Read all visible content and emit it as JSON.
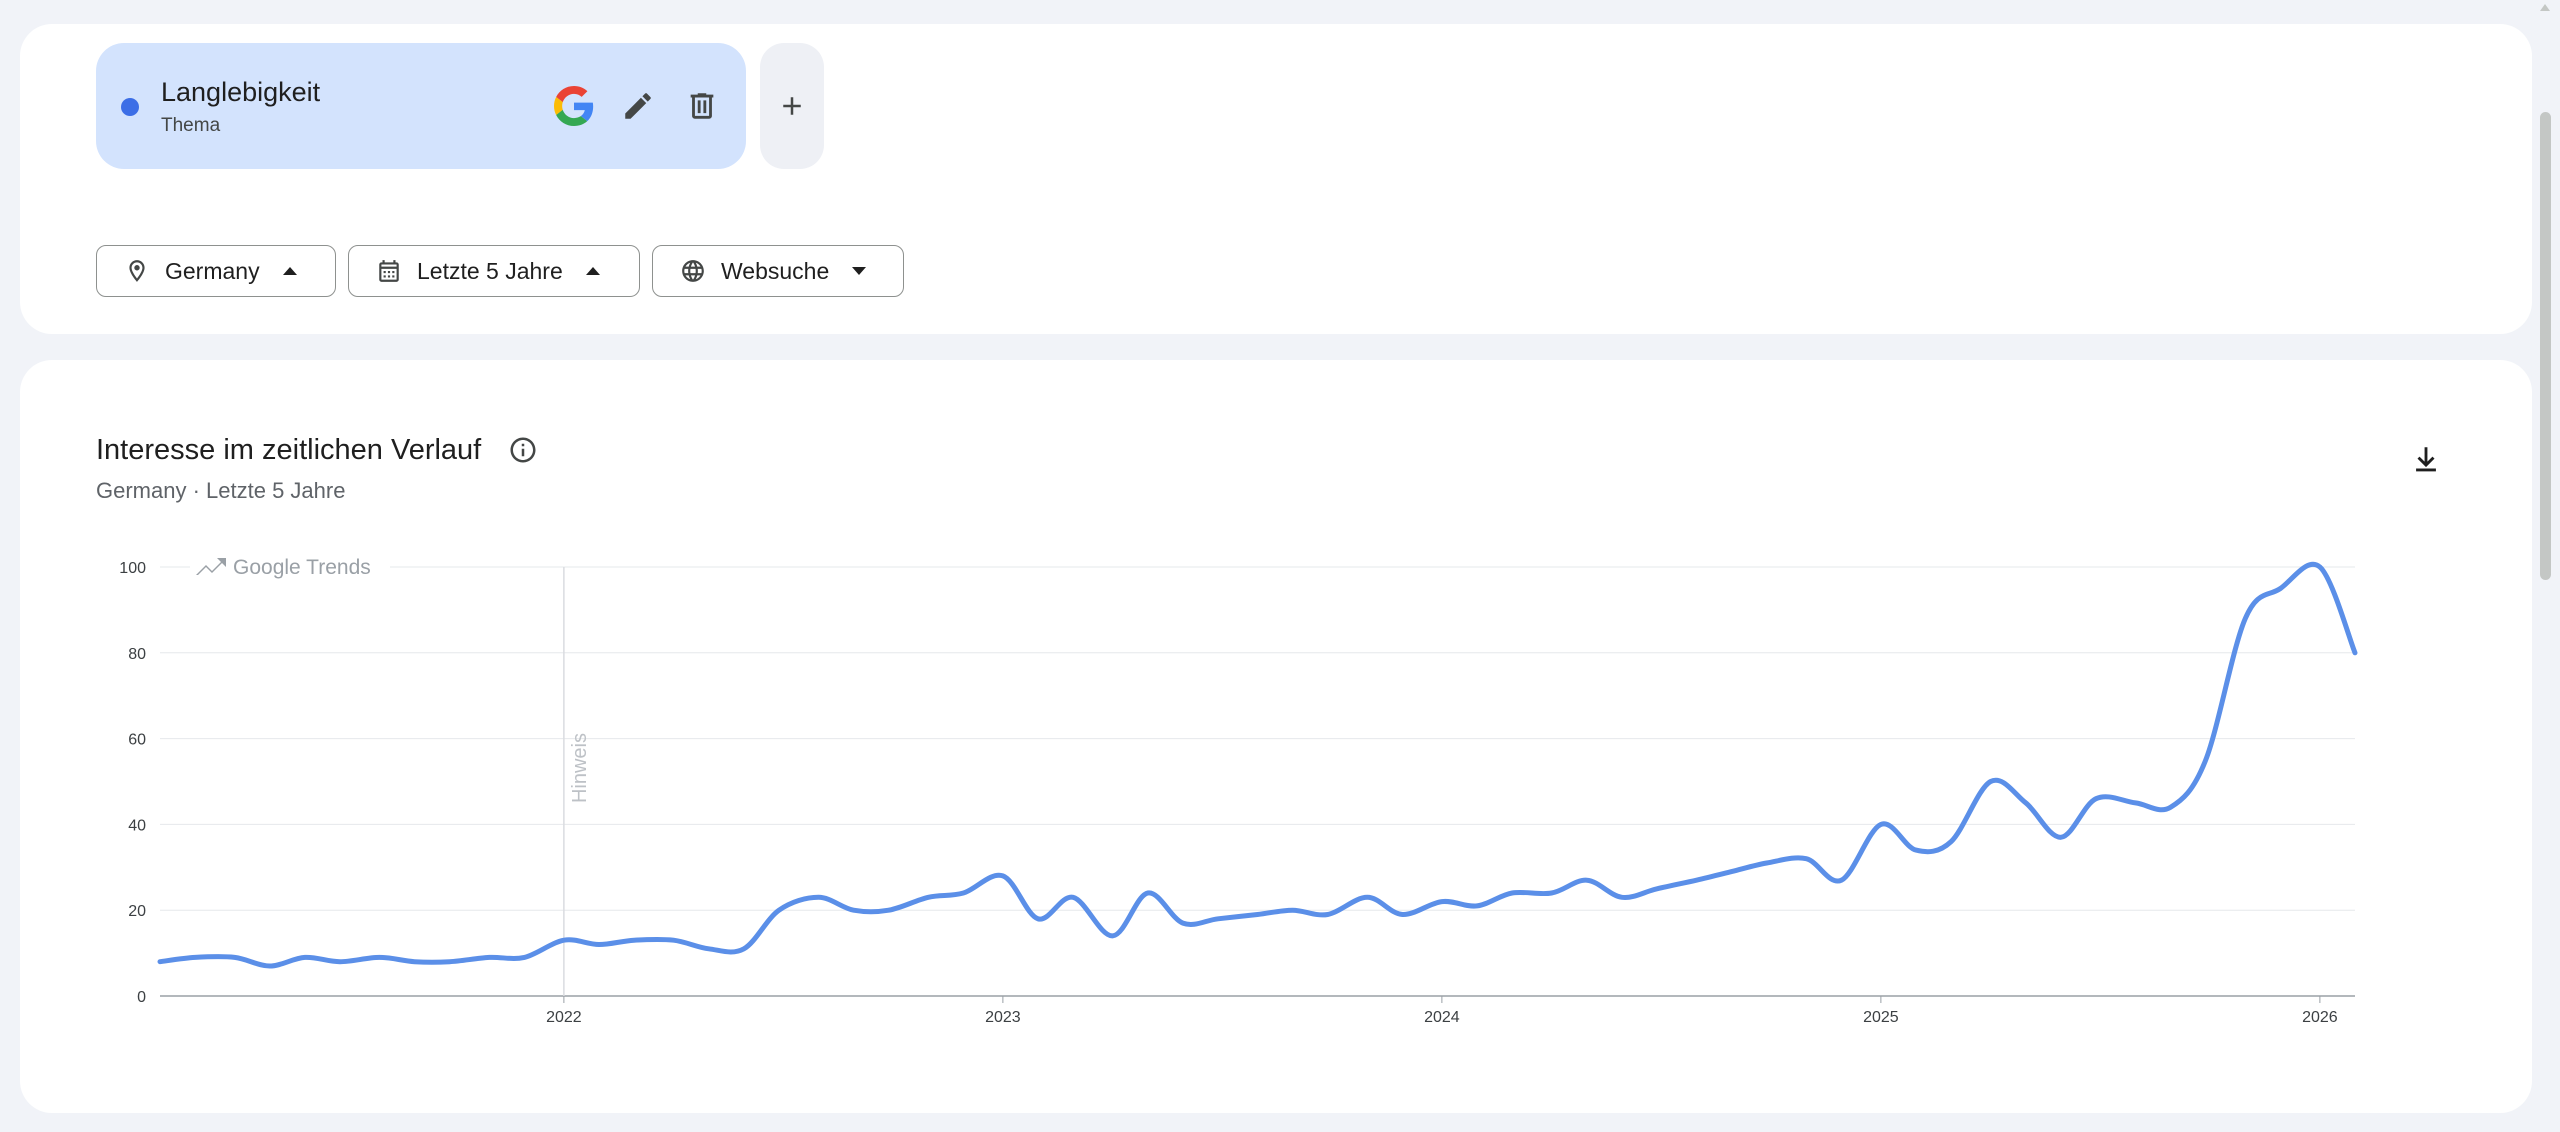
{
  "term": {
    "title": "Langlebigkeit",
    "subtitle": "Thema",
    "color": "#3c6ee6"
  },
  "icons": {
    "google": "google-g-icon",
    "edit": "pencil-icon",
    "delete": "trash-icon",
    "add": "plus-icon",
    "location": "location-pin-icon",
    "calendar": "calendar-icon",
    "web": "globe-icon",
    "info": "info-icon",
    "download": "download-icon"
  },
  "filters": {
    "geo": "Germany",
    "time": "Letzte 5 Jahre",
    "property": "Websuche"
  },
  "chart_section": {
    "title": "Interesse im zeitlichen Verlauf",
    "subtitle": "Germany · Letzte 5 Jahre",
    "watermark": "Google Trends",
    "note_label": "Hinweis"
  },
  "chart_data": {
    "type": "line",
    "title": "Interesse im zeitlichen Verlauf",
    "xlabel": "",
    "ylabel": "",
    "ylim": [
      0,
      100
    ],
    "yticks": [
      0,
      20,
      40,
      60,
      80,
      100
    ],
    "xticks": [
      2022,
      2023,
      2024,
      2025,
      2026
    ],
    "xlim": [
      2021.08,
      2026.08
    ],
    "grid": true,
    "line_color": "#5b8fe8",
    "annotation": {
      "x": 2022.0,
      "label": "Hinweis"
    },
    "series": [
      {
        "x": [
          2021.08,
          2021.16,
          2021.25,
          2021.33,
          2021.41,
          2021.49,
          2021.58,
          2021.66,
          2021.74,
          2021.83,
          2021.91,
          2022.0,
          2022.08,
          2022.16,
          2022.25,
          2022.33,
          2022.41,
          2022.49,
          2022.58,
          2022.66,
          2022.74,
          2022.83,
          2022.91,
          2023.0,
          2023.08,
          2023.16,
          2023.25,
          2023.33,
          2023.41,
          2023.49,
          2023.58,
          2023.66,
          2023.74,
          2023.83,
          2023.91,
          2024.0,
          2024.08,
          2024.16,
          2024.25,
          2024.33,
          2024.41,
          2024.49,
          2024.58,
          2024.66,
          2024.74,
          2024.83,
          2024.91,
          2025.0,
          2025.08,
          2025.16,
          2025.25,
          2025.33,
          2025.41,
          2025.49,
          2025.58,
          2025.66,
          2025.74,
          2025.83,
          2025.91,
          2026.0,
          2026.08
        ],
        "values": [
          8,
          9,
          9,
          7,
          9,
          8,
          9,
          8,
          8,
          9,
          9,
          13,
          12,
          13,
          13,
          11,
          11,
          20,
          23,
          20,
          20,
          23,
          24,
          28,
          18,
          23,
          14,
          24,
          17,
          18,
          19,
          20,
          19,
          23,
          19,
          22,
          21,
          24,
          24,
          27,
          23,
          25,
          27,
          29,
          31,
          32,
          27,
          40,
          34,
          36,
          50,
          45,
          37,
          46,
          45,
          44,
          55,
          88,
          95,
          100,
          80
        ]
      }
    ]
  }
}
